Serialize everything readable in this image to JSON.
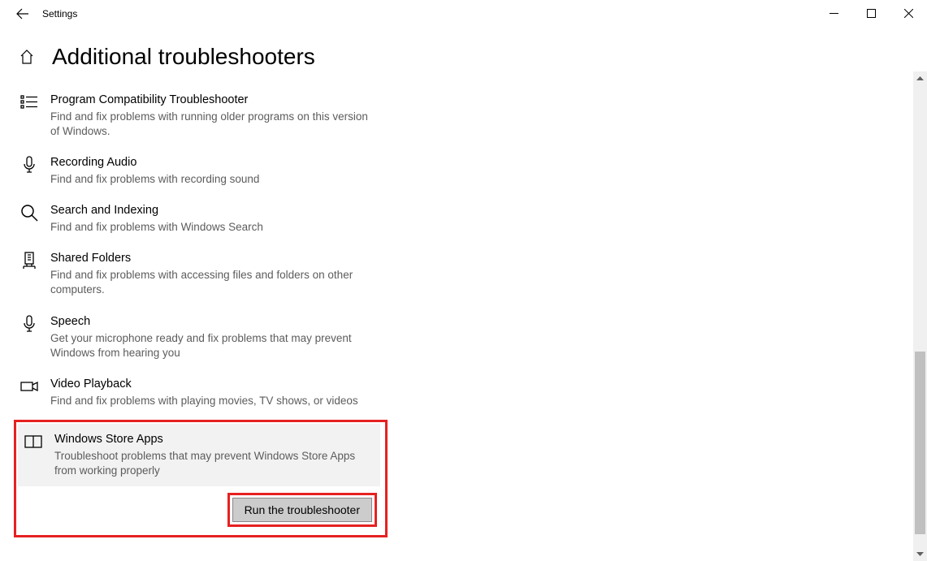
{
  "window": {
    "app_title": "Settings"
  },
  "page": {
    "title": "Additional troubleshooters"
  },
  "troubleshooters": [
    {
      "title": "Program Compatibility Troubleshooter",
      "desc": "Find and fix problems with running older programs on this version of Windows."
    },
    {
      "title": "Recording Audio",
      "desc": "Find and fix problems with recording sound"
    },
    {
      "title": "Search and Indexing",
      "desc": "Find and fix problems with Windows Search"
    },
    {
      "title": "Shared Folders",
      "desc": "Find and fix problems with accessing files and folders on other computers."
    },
    {
      "title": "Speech",
      "desc": "Get your microphone ready and fix problems that may prevent Windows from hearing you"
    },
    {
      "title": "Video Playback",
      "desc": "Find and fix problems with playing movies, TV shows, or videos"
    }
  ],
  "selected_troubleshooter": {
    "title": "Windows Store Apps",
    "desc": "Troubleshoot problems that may prevent Windows Store Apps from working properly",
    "run_label": "Run the troubleshooter"
  }
}
